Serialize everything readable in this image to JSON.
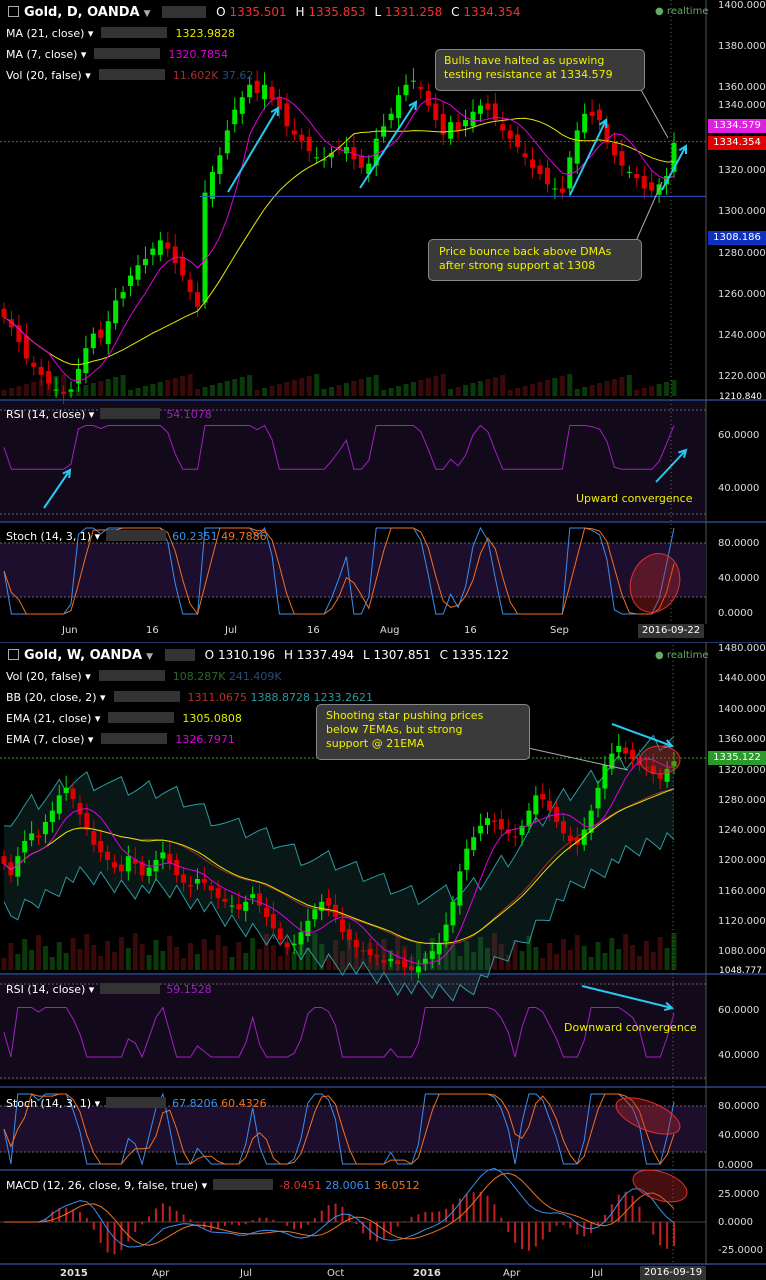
{
  "colors": {
    "bg": "#000000",
    "up": "#00e600",
    "down": "#e00000",
    "ma21": "#e6e600",
    "ma7": "#e000e0",
    "rsi": "#a020c0",
    "stochK": "#3a8ff0",
    "stochD": "#f07020",
    "arrow": "#29c8f0",
    "annotation_text": "#f0f000",
    "badge_resistance": "#e020e0",
    "badge_price": "#e00000",
    "badge_support": "#1030c0",
    "badge_weekly_price": "#2a9a2a"
  },
  "daily": {
    "symbol_title": "Gold, D, OANDA",
    "ohlc": {
      "o_label": "O",
      "o": "1335.501",
      "h_label": "H",
      "h": "1335.853",
      "l_label": "L",
      "l": "1331.258",
      "c_label": "C",
      "c": "1334.354"
    },
    "realtime": "realtime",
    "indicators": [
      {
        "name": "MA (21, close)",
        "value": "1323.9828"
      },
      {
        "name": "MA (7, close)",
        "value": "1320.7854"
      },
      {
        "name": "Vol (20, false)",
        "value": "11.602K",
        "value2": "37.62"
      }
    ],
    "rsi_label": "RSI (14, close)",
    "rsi_value": "54.1078",
    "stoch_label": "Stoch (14, 3, 1)",
    "stoch_k": "60.2351",
    "stoch_d": "49.7886",
    "annotation_top": [
      "Bulls have halted as upswing",
      "testing resistance at 1334.579"
    ],
    "annotation_bottom": [
      "Price bounce back above DMAs",
      "after strong support at 1308"
    ],
    "rsi_note": "Upward convergence",
    "badge_resistance": "1334.579",
    "badge_price": "1334.354",
    "badge_support": "1308.186",
    "badge_low": "1210.840",
    "date_badge": "2016-09-22",
    "price_ticks": [
      "1400.000",
      "1380.000",
      "1360.000",
      "1340.000",
      "1320.000",
      "1300.000",
      "1280.000",
      "1260.000",
      "1240.000",
      "1220.000"
    ],
    "rsi_ticks": [
      "60.0000",
      "40.0000"
    ],
    "stoch_ticks": [
      "80.0000",
      "40.0000",
      "0.0000"
    ],
    "x_ticks": [
      "Jun",
      "16",
      "Jul",
      "16",
      "Aug",
      "16",
      "Sep"
    ]
  },
  "weekly": {
    "symbol_title": "Gold, W, OANDA",
    "ohlc": {
      "o_label": "O",
      "o": "1310.196",
      "h_label": "H",
      "h": "1337.494",
      "l_label": "L",
      "l": "1307.851",
      "c_label": "C",
      "c": "1335.122"
    },
    "realtime": "realtime",
    "indicators": [
      {
        "name": "Vol (20, false)",
        "value": "108.287K",
        "value2": "241.409K"
      },
      {
        "name": "BB (20, close, 2)",
        "value": "1311.0675",
        "value2": "1388.8728",
        "value3": "1233.2621"
      },
      {
        "name": "EMA (21, close)",
        "value": "1305.0808"
      },
      {
        "name": "EMA (7, close)",
        "value": "1326.7971"
      }
    ],
    "annotation": [
      "Shooting star pushing prices",
      "below 7EMAs, but strong",
      "support @ 21EMA"
    ],
    "rsi_label": "RSI (14, close)",
    "rsi_value": "59.1528",
    "rsi_note": "Downward convergence",
    "stoch_label": "Stoch (14, 3, 1)",
    "stoch_k": "67.8206",
    "stoch_d": "60.4326",
    "macd_label": "MACD (12, 26, close, 9, false, true)",
    "macd_values": [
      "-8.0451",
      "28.0061",
      "36.0512"
    ],
    "badge_price": "1335.122",
    "badge_low": "1048.777",
    "date_badge": "2016-09-19",
    "price_ticks": [
      "1480.000",
      "1440.000",
      "1400.000",
      "1360.000",
      "1320.000",
      "1280.000",
      "1240.000",
      "1200.000",
      "1160.000",
      "1120.000",
      "1080.000"
    ],
    "rsi_ticks": [
      "60.0000",
      "40.0000"
    ],
    "stoch_ticks": [
      "80.0000",
      "40.0000",
      "0.0000"
    ],
    "macd_ticks": [
      "25.0000",
      "0.0000",
      "-25.0000"
    ],
    "x_ticks": [
      "2015",
      "Apr",
      "Jul",
      "Oct",
      "2016",
      "Apr",
      "Jul"
    ]
  },
  "chart_data": [
    {
      "type": "candlestick",
      "timeframe": "daily",
      "ylim": [
        1210,
        1400
      ],
      "resistance": 1334.579,
      "support": 1308.186,
      "close_approx": [
        1250,
        1245,
        1238,
        1230,
        1226,
        1222,
        1218,
        1215,
        1213,
        1215,
        1225,
        1235,
        1242,
        1240,
        1248,
        1258,
        1262,
        1270,
        1275,
        1278,
        1283,
        1287,
        1283,
        1276,
        1270,
        1262,
        1255,
        1310,
        1320,
        1328,
        1340,
        1350,
        1356,
        1362,
        1358,
        1362,
        1355,
        1350,
        1342,
        1338,
        1335,
        1330,
        1327,
        1326,
        1329,
        1331,
        1332,
        1326,
        1322,
        1324,
        1336,
        1342,
        1348,
        1357,
        1362,
        1364,
        1360,
        1352,
        1345,
        1338,
        1344,
        1340,
        1345,
        1349,
        1352,
        1350,
        1345,
        1340,
        1336,
        1332,
        1327,
        1322,
        1319,
        1314,
        1312,
        1310,
        1327,
        1340,
        1348,
        1347,
        1345,
        1334,
        1328,
        1323,
        1320,
        1317,
        1312,
        1311,
        1314,
        1318,
        1334
      ]
    },
    {
      "type": "candlestick",
      "timeframe": "weekly",
      "ylim": [
        1048,
        1480
      ],
      "close_approx": [
        1200,
        1185,
        1210,
        1230,
        1240,
        1235,
        1255,
        1270,
        1290,
        1300,
        1285,
        1265,
        1245,
        1225,
        1215,
        1205,
        1195,
        1190,
        1210,
        1200,
        1185,
        1195,
        1205,
        1215,
        1200,
        1185,
        1175,
        1170,
        1180,
        1175,
        1165,
        1155,
        1150,
        1145,
        1140,
        1150,
        1160,
        1145,
        1130,
        1115,
        1100,
        1090,
        1095,
        1110,
        1125,
        1140,
        1150,
        1145,
        1130,
        1110,
        1100,
        1090,
        1085,
        1080,
        1078,
        1070,
        1075,
        1068,
        1064,
        1060,
        1065,
        1075,
        1085,
        1095,
        1120,
        1150,
        1190,
        1220,
        1235,
        1250,
        1260,
        1255,
        1245,
        1240,
        1235,
        1250,
        1270,
        1290,
        1285,
        1270,
        1255,
        1240,
        1230,
        1225,
        1245,
        1270,
        1300,
        1330,
        1345,
        1355,
        1345,
        1338,
        1330,
        1325,
        1318,
        1312,
        1325,
        1335
      ]
    }
  ]
}
